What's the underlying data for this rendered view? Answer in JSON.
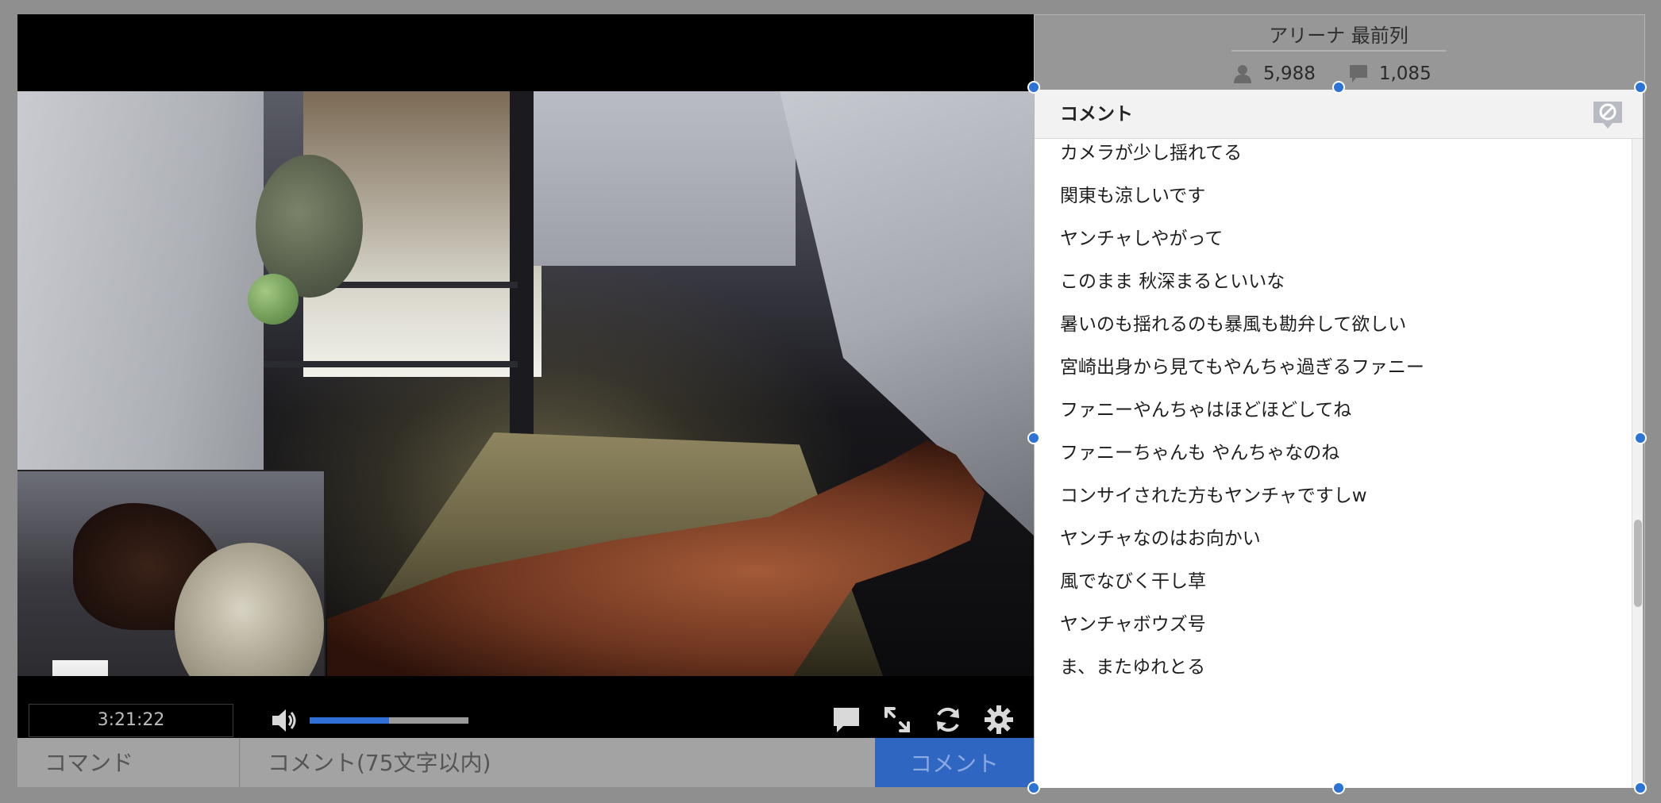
{
  "player": {
    "time": "3:21:22",
    "volume_level": 0.5
  },
  "input_bar": {
    "command_placeholder": "コマンド",
    "comment_placeholder": "コメント(75文字以内)",
    "submit_label": "コメント"
  },
  "room": {
    "name": "アリーナ 最前列",
    "viewers": "5,988",
    "comments": "1,085"
  },
  "comment_panel": {
    "title": "コメント",
    "items": [
      "カメラが少し揺れてる",
      "関東も涼しいです",
      "ヤンチャしやがって",
      "このまま 秋深まるといいな",
      "暑いのも揺れるのも暴風も勘弁して欲しい",
      "宮崎出身から見てもやんちゃ過ぎるファニー",
      "ファニーやんちゃはほどほどしてね",
      "ファニーちゃんも やんちゃなのね",
      "コンサイされた方もヤンチャですしw",
      "ヤンチャなのはお向かい",
      "風でなびく干し草",
      "ヤンチャボウズ号",
      "ま、またゆれとる"
    ]
  },
  "icons": {
    "volume": "speaker-icon",
    "comment_toggle": "comment-bubble-icon",
    "fullscreen": "fullscreen-icon",
    "reload": "reload-icon",
    "settings": "gear-icon",
    "ng": "ng-comment-icon",
    "viewer": "person-icon",
    "comment_count": "comment-count-icon"
  },
  "colors": {
    "accent": "#2e66c2",
    "volume_fill": "#2f6fd6",
    "handle": "#2b73d6"
  }
}
